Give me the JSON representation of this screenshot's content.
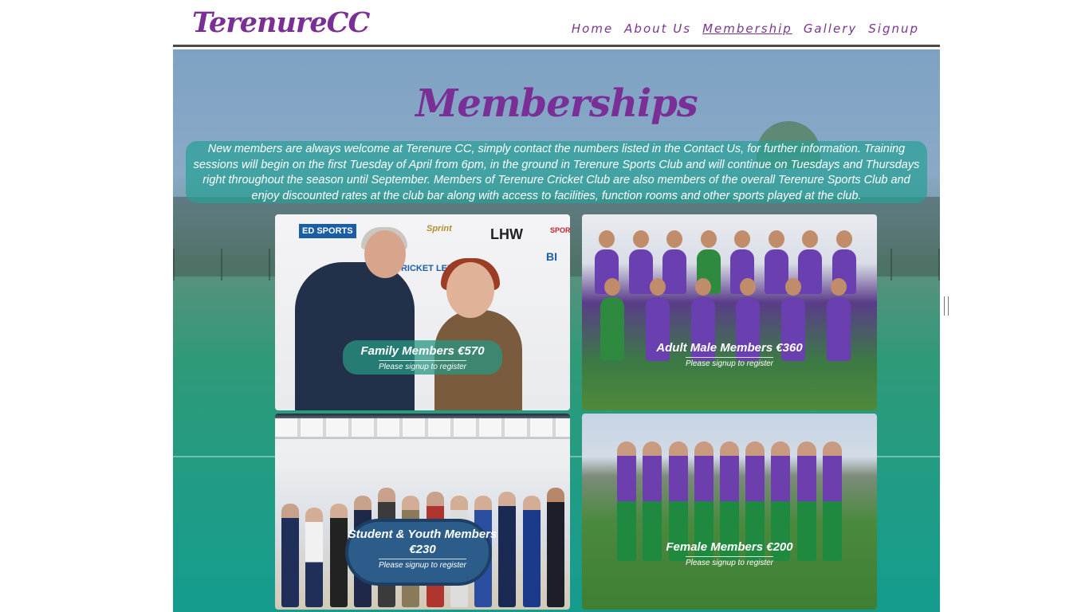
{
  "header": {
    "logo": "TerenureCC",
    "nav": [
      "Home",
      "About Us",
      "Membership",
      "Gallery",
      "Signup"
    ],
    "active_nav": "Membership"
  },
  "main": {
    "title": "Memberships",
    "intro": "New members are always welcome at Terenure CC, simply contact the numbers listed in the Contact Us, for further information. Training sessions will begin on the first Tuesday of April from 6pm, in the ground in Terenure Sports Club and will continue on Tuesdays and Thursdays right throughout the season until September. Members of Terenure Cricket Club are also members of the overall Terenure Sports Club and enjoy discounted rates at the club bar along with access to facilities, function rooms and other sports played at the club.",
    "cards": [
      {
        "name": "Family Members €570",
        "note": "Please signup to register"
      },
      {
        "name": "Adult Male Members €360",
        "note": "Please signup to register"
      },
      {
        "name": "Student & Youth Members €230",
        "note": "Please signup to register"
      },
      {
        "name": "Female Members €200",
        "note": "Please signup to register"
      }
    ]
  },
  "photo_text": {
    "c1_logos": [
      "ED SPORTS",
      "CRICKET LEINSTER",
      "BI",
      "LHW",
      "Sprint",
      "SPORTS"
    ]
  },
  "colors": {
    "brand_purple": "#7a2f96",
    "teal": "#1f9c86"
  }
}
